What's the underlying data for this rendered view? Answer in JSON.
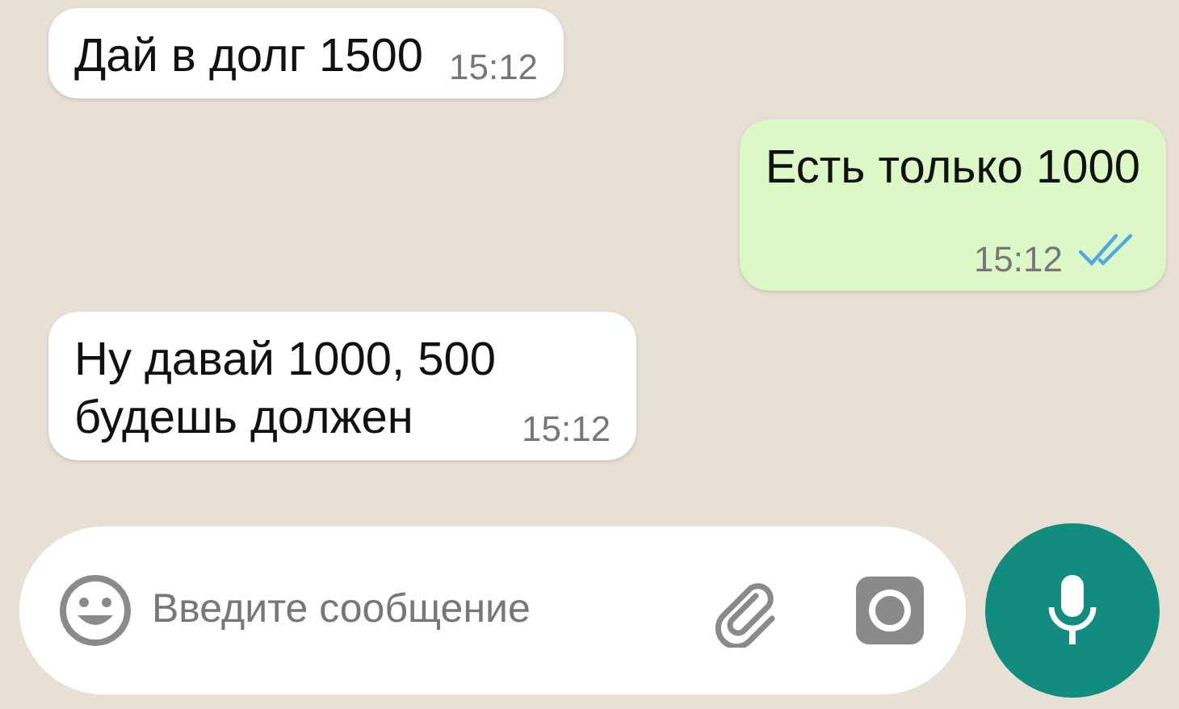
{
  "messages": [
    {
      "kind": "incoming",
      "text": "Дай в долг 1500",
      "time": "15:12"
    },
    {
      "kind": "outgoing",
      "text": "Есть только 1000",
      "time": "15:12",
      "read": true
    },
    {
      "kind": "incoming",
      "text": "Ну давай 1000, 500\nбудешь должен",
      "time": "15:12"
    }
  ],
  "composer": {
    "placeholder": "Введите сообщение"
  }
}
